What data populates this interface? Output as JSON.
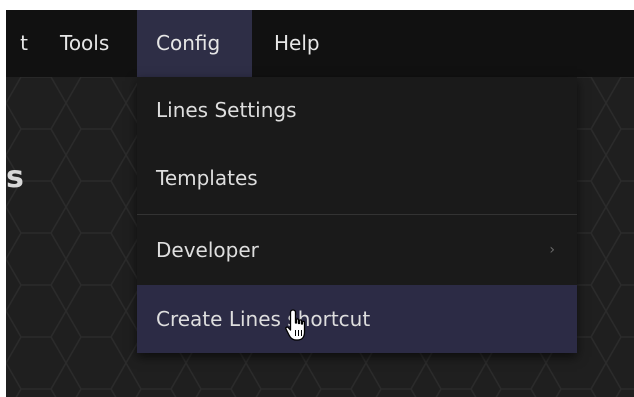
{
  "menubar": {
    "items": [
      {
        "label": "t"
      },
      {
        "label": "Tools"
      },
      {
        "label": "Config"
      },
      {
        "label": "Help"
      }
    ]
  },
  "page": {
    "heading_fragment": "s"
  },
  "config_menu": {
    "items": [
      {
        "label": "Lines Settings"
      },
      {
        "label": "Templates"
      },
      {
        "label": "Developer",
        "submenu_icon": "chevron-right-icon"
      },
      {
        "label": "Create Lines shortcut"
      }
    ]
  },
  "colors": {
    "menubar_bg": "#111111",
    "active_menu_bg": "#2e2e46",
    "dropdown_bg": "#1a1a1a",
    "highlight_bg": "#2c2b45",
    "workspace_bg": "#1f1f1f"
  }
}
